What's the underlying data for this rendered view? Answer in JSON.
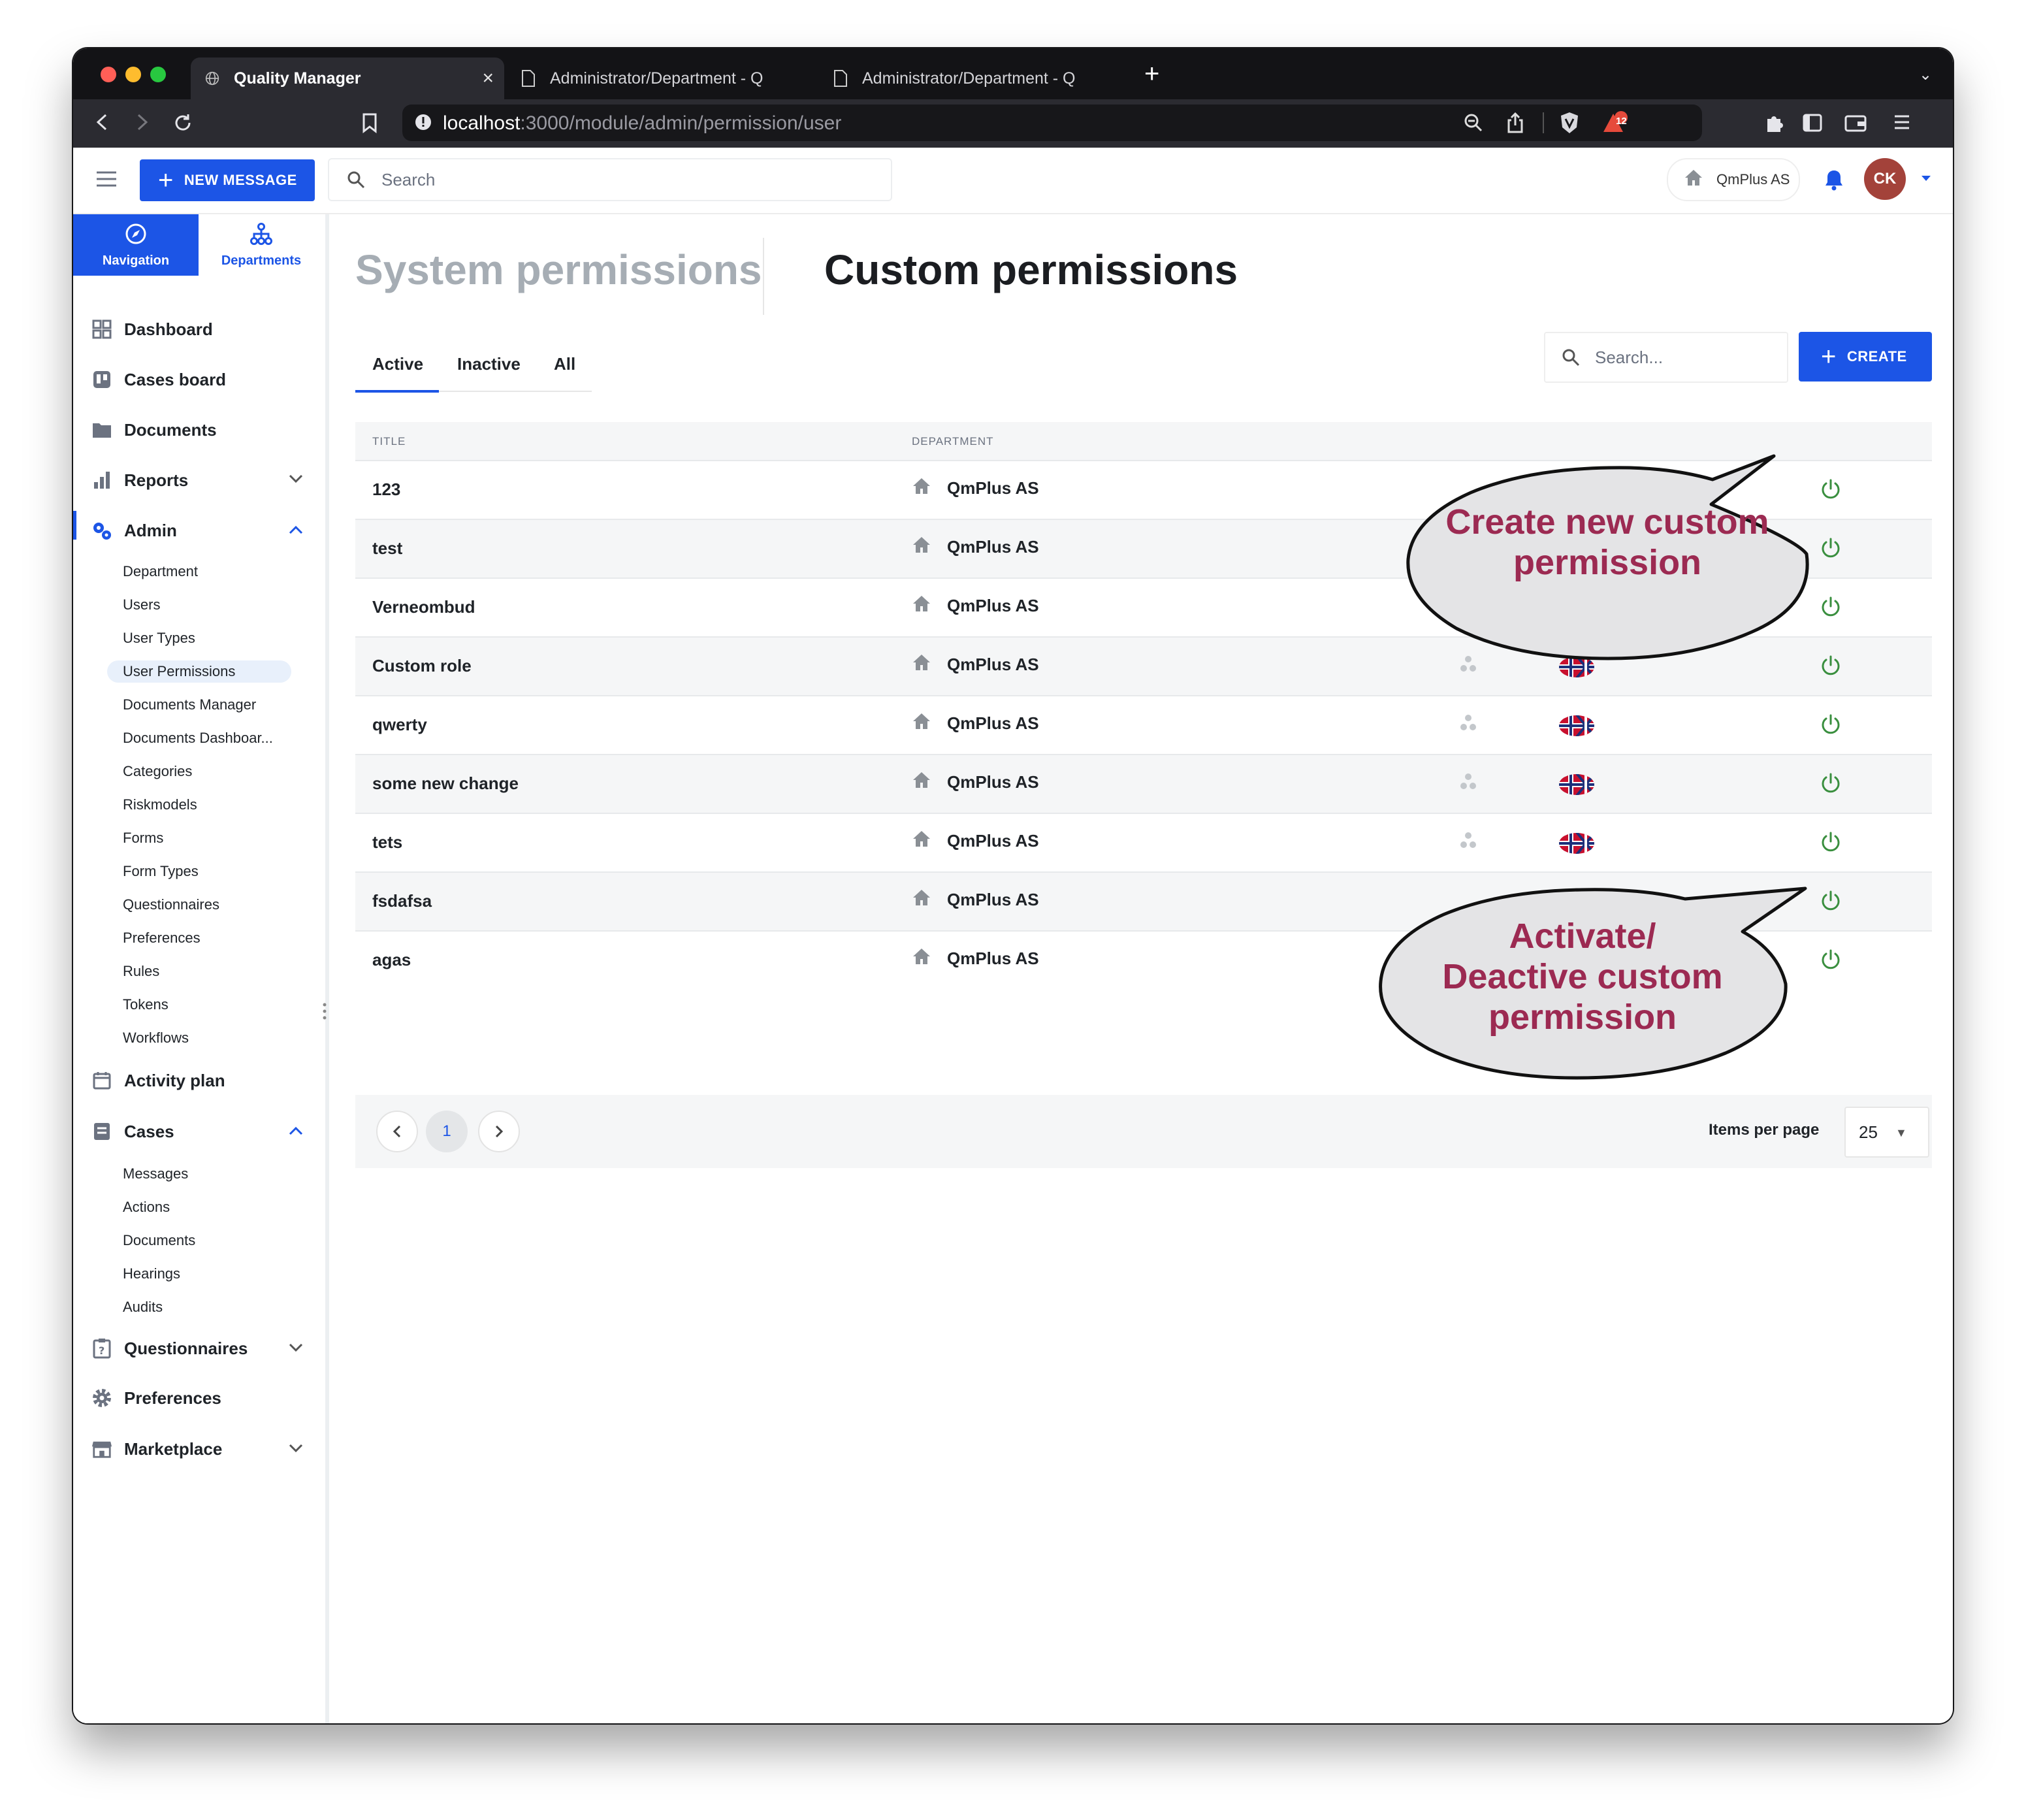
{
  "browser": {
    "tabs": [
      {
        "label": "Quality Manager",
        "active": true
      },
      {
        "label": "Administrator/Department - Q",
        "active": false
      },
      {
        "label": "Administrator/Department - Q",
        "active": false
      }
    ],
    "url_host": "localhost",
    "url_path": ":3000/module/admin/permission/user",
    "brave_badge": "12"
  },
  "header": {
    "new_message_label": "NEW MESSAGE",
    "search_placeholder": "Search",
    "org_label": "QmPlus AS",
    "avatar_initials": "CK"
  },
  "sidebar": {
    "tabs": [
      {
        "label": "Navigation",
        "icon": "compass-icon"
      },
      {
        "label": "Departments",
        "icon": "org-chart-icon"
      }
    ],
    "items": {
      "dashboard": "Dashboard",
      "cases_board": "Cases board",
      "documents": "Documents",
      "reports": "Reports",
      "admin": "Admin",
      "activity_plan": "Activity plan",
      "cases": "Cases",
      "questionnaires": "Questionnaires",
      "preferences": "Preferences",
      "marketplace": "Marketplace"
    },
    "admin_sub": [
      "Department",
      "Users",
      "User Types",
      "User Permissions",
      "Documents Manager",
      "Documents Dashboar...",
      "Categories",
      "Riskmodels",
      "Forms",
      "Form Types",
      "Questionnaires",
      "Preferences",
      "Rules",
      "Tokens",
      "Workflows"
    ],
    "cases_sub": [
      "Messages",
      "Actions",
      "Documents",
      "Hearings",
      "Audits"
    ]
  },
  "main": {
    "heading_system": "System permissions",
    "heading_custom": "Custom permissions",
    "tabs": [
      "Active",
      "Inactive",
      "All"
    ],
    "search_placeholder": "Search...",
    "create_label": "CREATE",
    "columns": {
      "title": "TITLE",
      "department": "DEPARTMENT"
    },
    "rows": [
      {
        "title": "123",
        "department": "QmPlus AS"
      },
      {
        "title": "test",
        "department": "QmPlus AS"
      },
      {
        "title": "Verneombud",
        "department": "QmPlus AS"
      },
      {
        "title": "Custom role",
        "department": "QmPlus AS"
      },
      {
        "title": "qwerty",
        "department": "QmPlus AS"
      },
      {
        "title": "some new change",
        "department": "QmPlus AS"
      },
      {
        "title": "tets",
        "department": "QmPlus AS"
      },
      {
        "title": "fsdafsa",
        "department": "QmPlus AS"
      },
      {
        "title": "agas",
        "department": "QmPlus AS"
      }
    ],
    "pager": {
      "current_page": "1",
      "items_per_page_label": "Items per page",
      "items_per_page": "25"
    }
  },
  "callouts": {
    "create": [
      "Create new custom",
      "permission"
    ],
    "activate": [
      "Activate/",
      "Deactive custom",
      "permission"
    ]
  },
  "colors": {
    "primary": "#1c55e6",
    "power_green": "#3a8f3f",
    "callout_text": "#9c2a52",
    "avatar": "#a3423a"
  }
}
